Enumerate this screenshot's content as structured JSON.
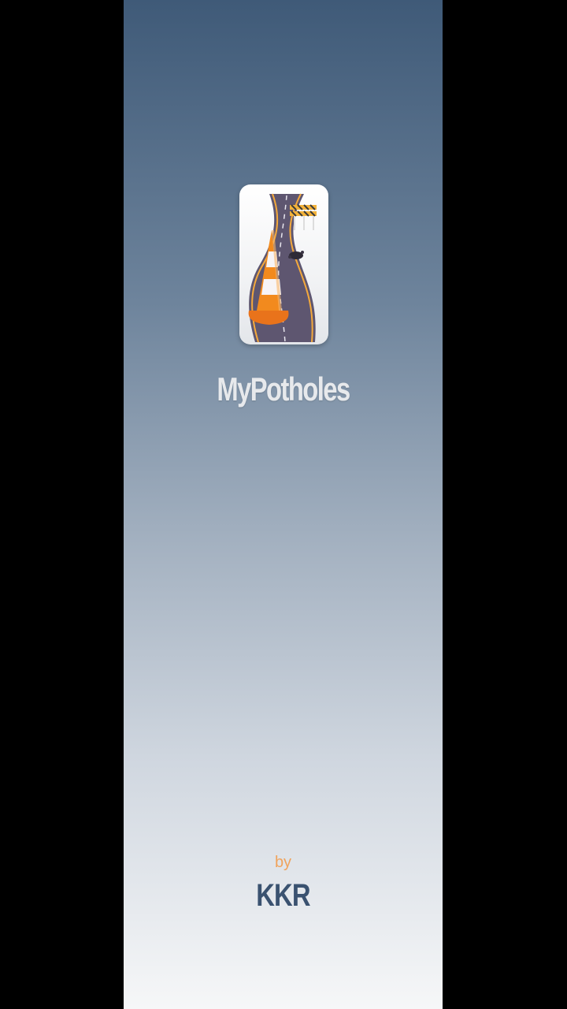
{
  "splash": {
    "app_name": "MyPotholes",
    "by_label": "by",
    "company": "KKR",
    "icon_name": "app-logo-road-cone-icon"
  },
  "colors": {
    "gradient_top": "#3f5a78",
    "gradient_bottom": "#f6f7f8",
    "by_color": "#f0a35c",
    "company_color": "#3a5270",
    "cone_orange": "#f28a1e",
    "road": "#5e5670"
  }
}
